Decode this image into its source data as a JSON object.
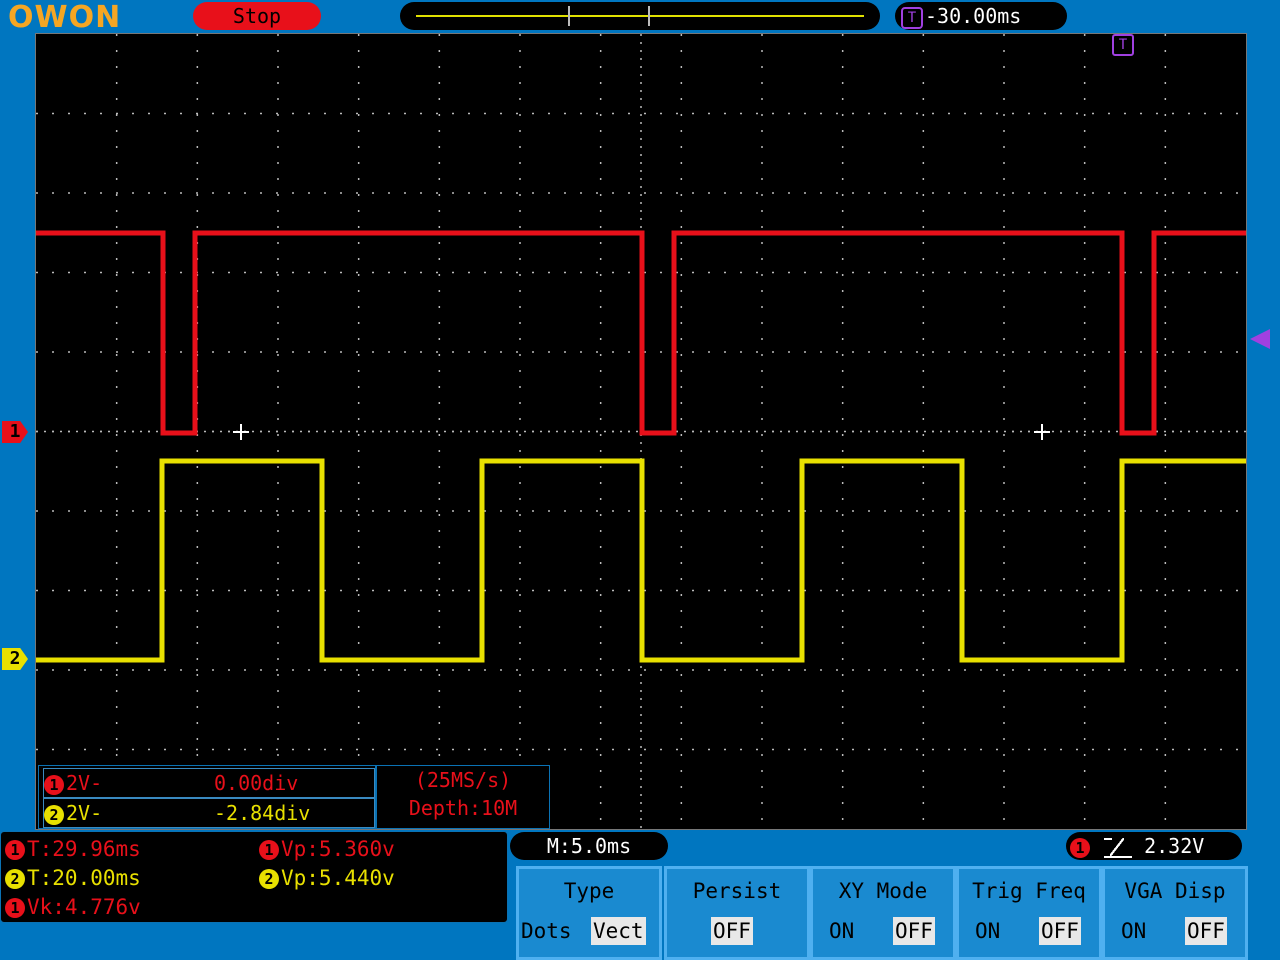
{
  "header": {
    "logo": "OWON",
    "run_status": "Stop",
    "trigger_icon": "T",
    "trigger_time": "-30.00ms"
  },
  "markers": {
    "ch1": "1",
    "ch2": "2",
    "trigger_pos": "T"
  },
  "channel_info": {
    "ch1": {
      "num": "1",
      "scale": "2V-",
      "offset": "0.00div"
    },
    "ch2": {
      "num": "2",
      "scale": "2V-",
      "offset": "-2.84div"
    }
  },
  "sample_info": {
    "rate": "(25MS/s)",
    "depth": "Depth:10M"
  },
  "measurements": [
    {
      "num": "1",
      "text": "T:29.96ms",
      "color": "#e8101a"
    },
    {
      "num": "1",
      "text": "Vp:5.360v",
      "color": "#e8101a"
    },
    {
      "num": "2",
      "text": "T:20.00ms",
      "color": "#e8e000"
    },
    {
      "num": "2",
      "text": "Vp:5.440v",
      "color": "#e8e000"
    },
    {
      "num": "1",
      "text": "Vk:4.776v",
      "color": "#e8101a"
    }
  ],
  "timebase": "M:5.0ms",
  "trigger": {
    "num": "1",
    "edge": "˥\\",
    "level": "2.32V"
  },
  "menu": [
    {
      "title": "Type",
      "options": [
        "Dots",
        "Vect"
      ],
      "selected": 1
    },
    {
      "title": "Persist",
      "options": [
        "OFF"
      ],
      "selected": 0
    },
    {
      "title": "XY Mode",
      "options": [
        "ON",
        "OFF"
      ],
      "selected": 1
    },
    {
      "title": "Trig Freq",
      "options": [
        "ON",
        "OFF"
      ],
      "selected": 1
    },
    {
      "title": "VGA Disp",
      "options": [
        "ON",
        "OFF"
      ],
      "selected": 1
    }
  ],
  "colors": {
    "ch1": "#e8101a",
    "ch2": "#e8e000",
    "trigger": "#a040e0",
    "background": "#0076c0"
  }
}
